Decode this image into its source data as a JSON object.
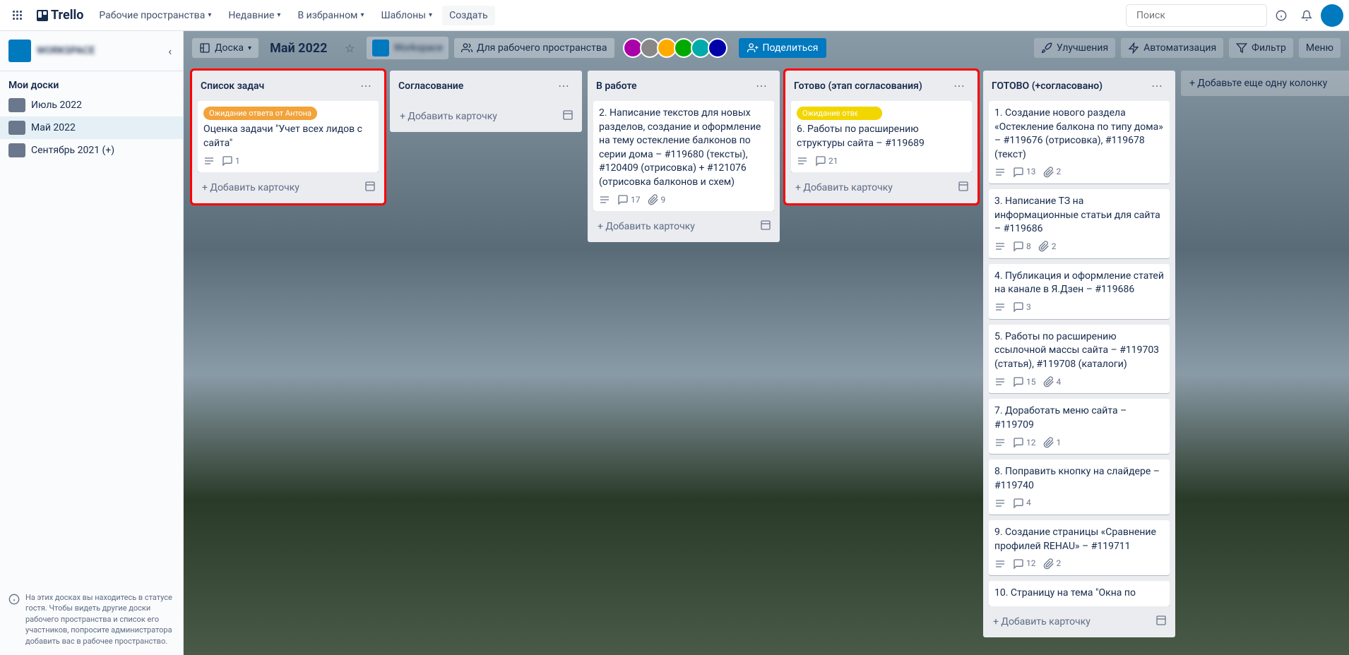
{
  "nav": {
    "logo": "Trello",
    "workspaces": "Рабочие пространства",
    "recent": "Недавние",
    "starred": "В избранном",
    "templates": "Шаблоны",
    "create": "Создать",
    "search_placeholder": "Поиск"
  },
  "sidebar": {
    "workspace_name": "WORKSPACE",
    "section": "Мои доски",
    "boards": [
      {
        "name": "Июль 2022",
        "active": false
      },
      {
        "name": "Май 2022",
        "active": true
      },
      {
        "name": "Сентябрь 2021 (+)",
        "active": false
      }
    ],
    "footer_text": "На этих досках вы находитесь в статусе гостя. Чтобы видеть другие доски рабочего пространства и список его участников, попросите администратора добавить вас в рабочее пространство."
  },
  "board": {
    "view_label": "Доска",
    "title": "Май 2022",
    "workspace_chip": "Workspace",
    "visibility": "Для рабочего пространства",
    "share": "Поделиться",
    "improvements": "Улучшения",
    "automation": "Автоматизация",
    "filter": "Фильтр",
    "menu": "Меню",
    "add_list": "Добавьте еще одну колонку",
    "add_card": "Добавить карточку"
  },
  "lists": [
    {
      "title": "Список задач",
      "highlighted": true,
      "cards": [
        {
          "label": "Ожидание ответа от Антона",
          "label_color": "orange",
          "text": "Оценка задачи \"Учет всех лидов с сайта\"",
          "desc": true,
          "comments": 1
        }
      ]
    },
    {
      "title": "Согласование",
      "cards": []
    },
    {
      "title": "В работе",
      "cards": [
        {
          "text": "2. Написание текстов для новых разделов, создание и оформление на тему остекление балконов по серии дома – #119680 (тексты), #120409 (отрисовка) + #121076 (отрисовка балконов и схем)",
          "desc": true,
          "comments": 17,
          "attachments": 9
        }
      ]
    },
    {
      "title": "Готово (этап согласования)",
      "highlighted": true,
      "cards": [
        {
          "label": "Ожидание ответа от",
          "label_color": "yellow",
          "text": "6. Работы по расширению структуры сайта – #119689",
          "desc": true,
          "comments": 21
        }
      ]
    },
    {
      "title": "ГОТОВО (+согласовано)",
      "cards": [
        {
          "text": "1. Создание нового раздела «Остекление балкона по типу дома» – #119676 (отрисовка), #119678 (текст)",
          "desc": true,
          "comments": 13,
          "attachments": 2
        },
        {
          "text": "3. Написание ТЗ на информационные статьи для сайта – #119686",
          "desc": true,
          "comments": 8,
          "attachments": 2
        },
        {
          "text": "4. Публикация и оформление статей на канале в Я.Дзен – #119686",
          "desc": true,
          "comments": 3
        },
        {
          "text": "5. Работы по расширению ссылочной массы сайта – #119703 (статья), #119708 (каталоги)",
          "desc": true,
          "comments": 15,
          "attachments": 4
        },
        {
          "text": "7. Доработать меню сайта – #119709",
          "desc": true,
          "comments": 12,
          "attachments": 1
        },
        {
          "text": "8. Поправить кнопку на слайдере – #119740",
          "desc": true,
          "comments": 4
        },
        {
          "text": "9. Создание страницы «Сравнение профилей REHAU» – #119711",
          "desc": true,
          "comments": 12,
          "attachments": 2
        },
        {
          "text": "10. Страницу на тема \"Окна по"
        }
      ]
    }
  ]
}
